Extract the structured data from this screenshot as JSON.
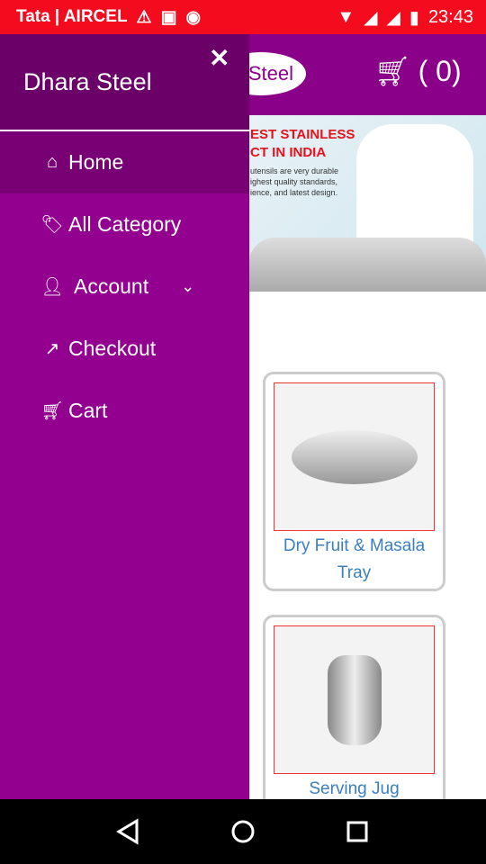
{
  "status_bar": {
    "carrier": "Tata | AIRCEL",
    "time": "23:43",
    "icons": [
      "warning-icon",
      "image-icon",
      "sync-icon",
      "wifi-icon",
      "signal-icon",
      "signal-icon",
      "battery-icon"
    ]
  },
  "header": {
    "logo_text": "Steel",
    "cart_count": "( 0)"
  },
  "banner": {
    "headline_1": "EST STAINLESS",
    "headline_2": "CT IN INDIA",
    "body_1": "utensils are very durable",
    "body_2": "ighest quality standards,",
    "body_3": "ience, and latest design."
  },
  "products": [
    {
      "name": "Dry Fruit & Masala Tray"
    },
    {
      "name": "Serving Jug"
    }
  ],
  "drawer": {
    "title": "Dhara Steel",
    "items": [
      {
        "label": "Home",
        "icon": "home-icon"
      },
      {
        "label": "All Category",
        "icon": "tags-icon"
      },
      {
        "label": "Account",
        "icon": "user-icon"
      },
      {
        "label": "Checkout",
        "icon": "share-icon"
      },
      {
        "label": "Cart",
        "icon": "cart-icon"
      }
    ]
  },
  "colors": {
    "status": "#f40b1d",
    "header": "#8b0089",
    "drawer": "#93008f",
    "drawer_head": "#6b0068",
    "link": "#3a7fc1"
  }
}
